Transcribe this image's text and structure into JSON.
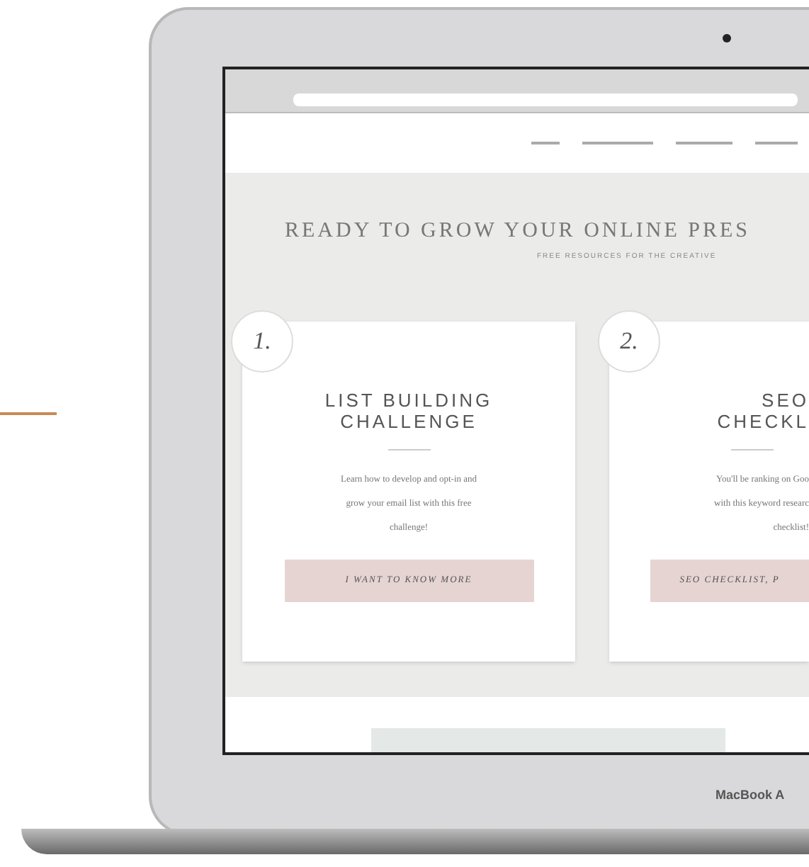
{
  "hero": {
    "title": "READY TO GROW YOUR ONLINE PRES",
    "subtitle": "FREE RESOURCES FOR THE CREATIVE"
  },
  "cards": [
    {
      "number": "1.",
      "title": [
        "LIST BUILDING",
        "CHALLENGE"
      ],
      "text": [
        "Learn how to develop and opt-in and",
        "grow your email list with this free",
        "challenge!"
      ],
      "button": "I WANT TO KNOW MORE"
    },
    {
      "number": "2.",
      "title": [
        "SEO",
        "CHECKL"
      ],
      "text": [
        "You'll be ranking on Goo",
        "with this keyword researc",
        "checklist!"
      ],
      "button": "SEO CHECKLIST, P"
    }
  ],
  "laptop": {
    "label": "MacBook A"
  }
}
